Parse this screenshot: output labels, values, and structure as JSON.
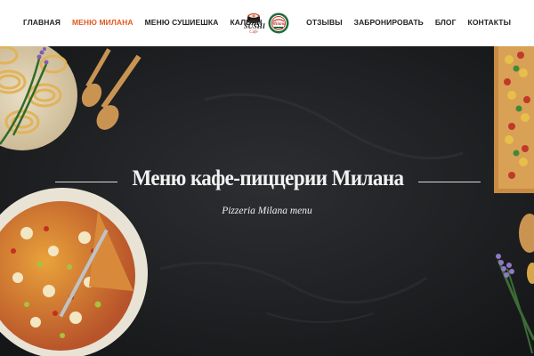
{
  "header": {
    "nav_left": [
      "ГЛАВНАЯ",
      "МЕНЮ МИЛАНА",
      "МЕНЮ СУШИЕШКА",
      "КАЛЬЯН"
    ],
    "nav_right": [
      "ОТЗЫВЫ",
      "ЗАБРОНИРОВАТЬ",
      "БЛОГ",
      "КОНТАКТЫ"
    ],
    "active_item": "МЕНЮ МИЛАНА",
    "logo_sushi": {
      "lettering": "SUSHI",
      "sub": "Cafe"
    },
    "logo_milana": {
      "lettering": "Milana"
    }
  },
  "hero": {
    "title": "Меню кафе-пиццерии Милана",
    "subtitle": "Pizzeria Milana menu",
    "images": [
      "pasta-plate",
      "wooden-spoons",
      "pizza",
      "colored-pasta-tray",
      "lavender"
    ]
  },
  "colors": {
    "accent": "#e05a20",
    "nav_text": "#222222",
    "hero_background": "#1b1d1f",
    "hero_text": "#f2f2f2",
    "logo_green": "#1f6b3a",
    "logo_red": "#c0392b"
  }
}
